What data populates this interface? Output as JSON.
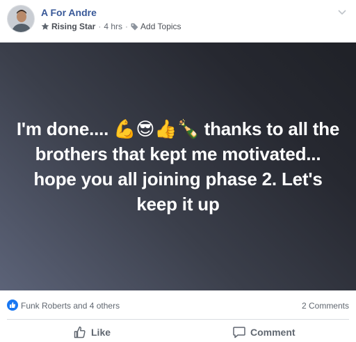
{
  "post": {
    "author": "A For Andre",
    "badge": "Rising Star",
    "time": "4 hrs",
    "separator": "·",
    "add_topics": "Add Topics",
    "text": "I'm done.... 💪😎👍🍾 thanks to all the brothers that kept me motivated... hope you all joining phase 2. Let's keep it up"
  },
  "reactions": {
    "summary": "Funk Roberts and 4 others",
    "comments": "2 Comments"
  },
  "actions": {
    "like_label": "Like",
    "comment_label": "Comment"
  },
  "colors": {
    "author": "#385898",
    "reaction_blue": "#1877f2",
    "muted_text": "#606770"
  },
  "icons": {
    "badge": "star-icon",
    "topics": "tag-icon",
    "menu": "chevron-down-icon",
    "reaction": "like-reaction-icon",
    "like": "thumbs-up-icon",
    "comment": "comment-bubble-icon"
  }
}
